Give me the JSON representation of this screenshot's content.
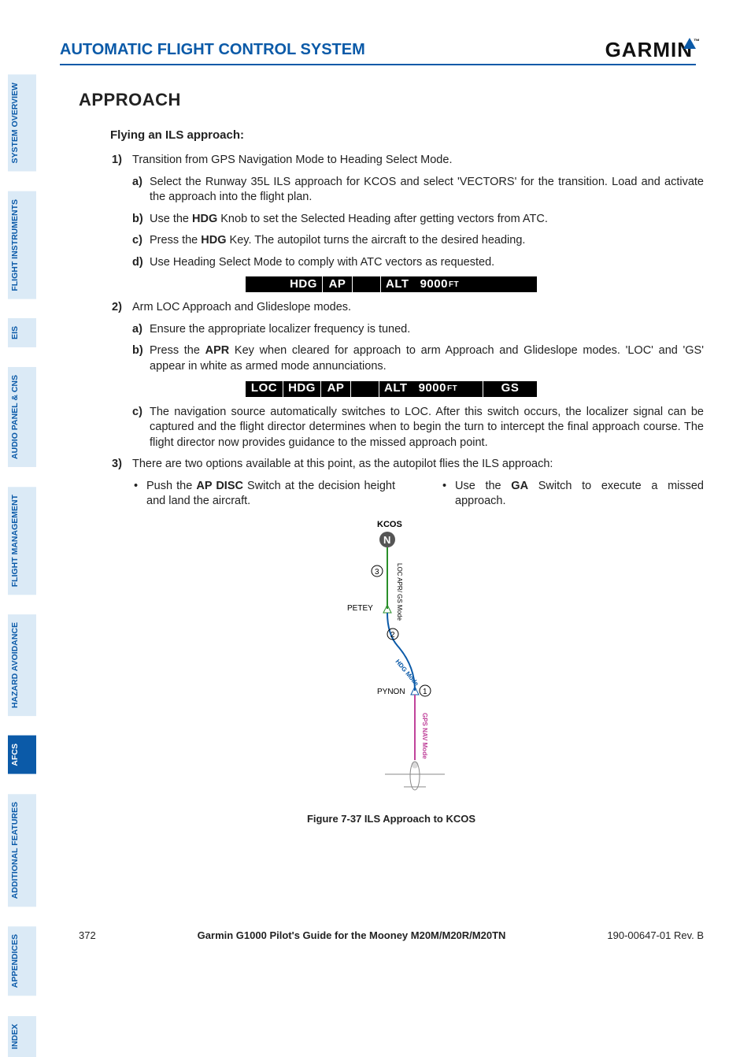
{
  "header": {
    "title": "AUTOMATIC FLIGHT CONTROL SYSTEM",
    "logo": "GARMIN"
  },
  "sidebar": {
    "tabs": [
      {
        "label": "SYSTEM OVERVIEW",
        "active": false
      },
      {
        "label": "FLIGHT INSTRUMENTS",
        "active": false
      },
      {
        "label": "EIS",
        "active": false
      },
      {
        "label": "AUDIO PANEL & CNS",
        "active": false
      },
      {
        "label": "FLIGHT MANAGEMENT",
        "active": false
      },
      {
        "label": "HAZARD AVOIDANCE",
        "active": false
      },
      {
        "label": "AFCS",
        "active": true
      },
      {
        "label": "ADDITIONAL FEATURES",
        "active": false
      },
      {
        "label": "APPENDICES",
        "active": false
      },
      {
        "label": "INDEX",
        "active": false
      }
    ]
  },
  "section_title": "APPROACH",
  "subhead": "Flying an ILS approach:",
  "s1": {
    "no": "1)",
    "txt": "Transition from GPS Navigation Mode to Heading Select Mode."
  },
  "s1a": {
    "no": "a)",
    "txt": "Select the Runway 35L ILS approach for KCOS and select 'VECTORS' for the transition.  Load and activate the approach into the flight plan."
  },
  "s1b": {
    "no": "b)",
    "pre": "Use the ",
    "kw": "HDG",
    "post": " Knob to set the Selected Heading after getting vectors from ATC."
  },
  "s1c": {
    "no": "c)",
    "pre": "Press the ",
    "kw": "HDG",
    "post": " Key.  The autopilot turns the aircraft to the desired heading."
  },
  "s1d": {
    "no": "d)",
    "txt": "Use Heading Select Mode to comply with ATC vectors as requested."
  },
  "bar1": {
    "hdg": "HDG",
    "ap": "AP",
    "alt": "ALT",
    "val": "9000",
    "ft": "FT"
  },
  "s2": {
    "no": "2)",
    "txt": "Arm LOC Approach and Glideslope modes."
  },
  "s2a": {
    "no": "a)",
    "txt": "Ensure the appropriate localizer frequency is tuned."
  },
  "s2b": {
    "no": "b)",
    "pre": "Press the ",
    "kw": "APR",
    "post": " Key when cleared for approach to arm Approach and Glideslope modes.  'LOC' and 'GS' appear in white as armed mode annunciations."
  },
  "bar2": {
    "loc": "LOC",
    "hdg": "HDG",
    "ap": "AP",
    "alt": "ALT",
    "val": "9000",
    "ft": "FT",
    "gs": "GS"
  },
  "s2c": {
    "no": "c)",
    "txt": "The navigation source automatically switches to LOC.  After this switch occurs, the localizer signal can be captured and the flight director determines when to begin the turn to intercept the final approach course.  The flight director now provides guidance to the missed approach point."
  },
  "s3": {
    "no": "3)",
    "txt": "There are two options available at this point, as the autopilot flies the ILS approach:"
  },
  "opt1": {
    "pre": "Push the ",
    "kw": "AP DISC",
    "post": " Switch at the decision height and land the aircraft."
  },
  "opt2": {
    "pre": "Use the ",
    "kw": "GA",
    "post": " Switch to execute a missed approach."
  },
  "diagram": {
    "kcos": "KCOS",
    "petey": "PETEY",
    "pynon": "PYNON",
    "lbl_locapr": "LOC APR/ GS Mode",
    "lbl_hdg": "HDG Mode",
    "lbl_gps": "GPS NAV Mode",
    "n1": "1",
    "n2": "2",
    "n3": "3"
  },
  "figcaption": "Figure 7-37  ILS Approach to KCOS",
  "footer": {
    "page": "372",
    "title": "Garmin G1000 Pilot's Guide for the Mooney M20M/M20R/M20TN",
    "rev": "190-00647-01   Rev. B"
  }
}
